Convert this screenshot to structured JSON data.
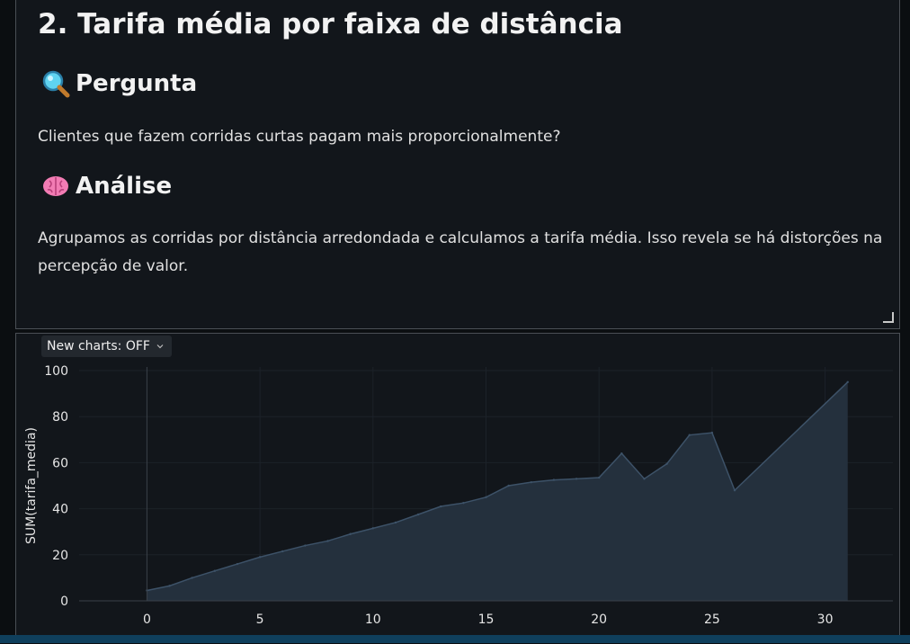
{
  "markdown": {
    "title": "2. Tarifa média por faixa de distância",
    "question_heading": "Pergunta",
    "question_icon": "magnifying-glass-icon",
    "question_text": "Clientes que fazem corridas curtas pagam mais proporcionalmente?",
    "analysis_heading": "Análise",
    "analysis_icon": "brain-icon",
    "analysis_text": "Agrupamos as corridas por distância arredondada e calculamos a tarifa média. Isso revela se há distorções na percepção de valor."
  },
  "chart_toolbar": {
    "toggle_label": "New charts: OFF"
  },
  "colors": {
    "area_fill": "#24303d",
    "area_line": "#3d5268",
    "background": "#12161b"
  },
  "chart_data": {
    "type": "area",
    "ylabel": "SUM(tarifa_media)",
    "xlabel": "",
    "xlim": [
      -3,
      33
    ],
    "ylim": [
      0,
      100
    ],
    "x_ticks": [
      0,
      5,
      10,
      15,
      20,
      25,
      30
    ],
    "y_ticks": [
      0,
      20,
      40,
      60,
      80,
      100
    ],
    "grid": true,
    "x": [
      0,
      1,
      2,
      3,
      4,
      5,
      6,
      7,
      8,
      9,
      10,
      11,
      12,
      13,
      14,
      15,
      16,
      17,
      18,
      19,
      20,
      21,
      22,
      23,
      24,
      25,
      26,
      31
    ],
    "values": [
      4.5,
      6.5,
      10,
      13,
      16,
      19,
      21.5,
      24,
      26,
      29,
      31.5,
      34,
      37.5,
      41,
      42.5,
      45,
      50,
      51.5,
      52.5,
      53,
      53.5,
      64,
      53,
      59.5,
      72,
      73,
      48,
      95
    ]
  }
}
